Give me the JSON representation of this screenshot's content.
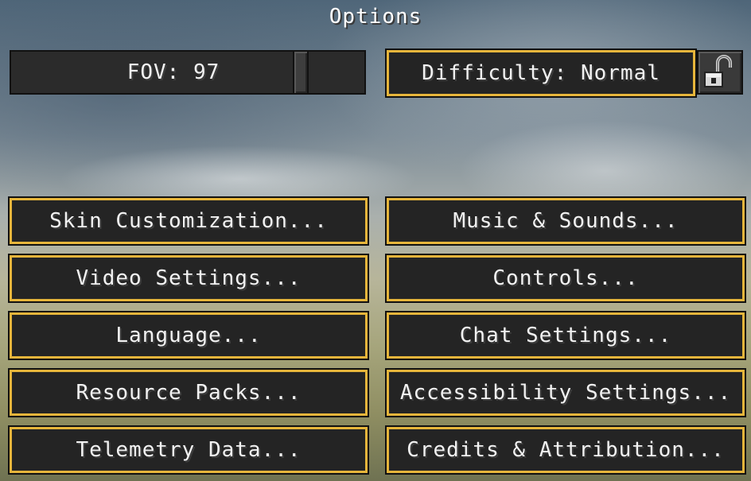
{
  "screen": {
    "title": "Options"
  },
  "fov_slider": {
    "label": "FOV: 97",
    "value": 97
  },
  "difficulty": {
    "label": "Difficulty: Normal",
    "lock_icon": "unlocked-padlock-icon"
  },
  "buttons": {
    "skin": "Skin Customization...",
    "music": "Music & Sounds...",
    "video": "Video Settings...",
    "controls": "Controls...",
    "language": "Language...",
    "chat": "Chat Settings...",
    "resource": "Resource Packs...",
    "accessibility": "Accessibility Settings...",
    "telemetry": "Telemetry Data...",
    "credits": "Credits & Attribution..."
  },
  "colors": {
    "button_border": "#e6b53b",
    "button_bg": "#242424",
    "text": "#f2f2f2"
  }
}
